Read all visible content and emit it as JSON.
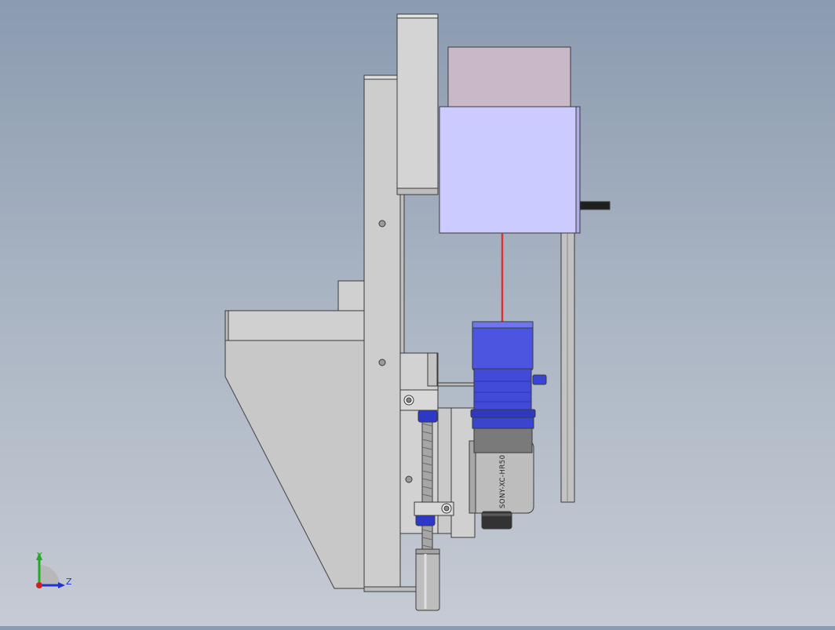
{
  "app": {
    "view": "CAD assembly model viewport"
  },
  "model": {
    "camera_label": "SONY-XC-HR50",
    "laser_color": "#e03030",
    "lens_color": "#4b55e0",
    "housing_color": "#cccbff",
    "top_block_color": "#c9b8c8",
    "plate_color": "#c8c8c8",
    "nut_color": "#2d38c8"
  },
  "triad": {
    "y_label": "Y",
    "z_label": "Z",
    "y_color": "#22aa22",
    "z_color": "#2233cc",
    "origin_color": "#cc2222"
  }
}
